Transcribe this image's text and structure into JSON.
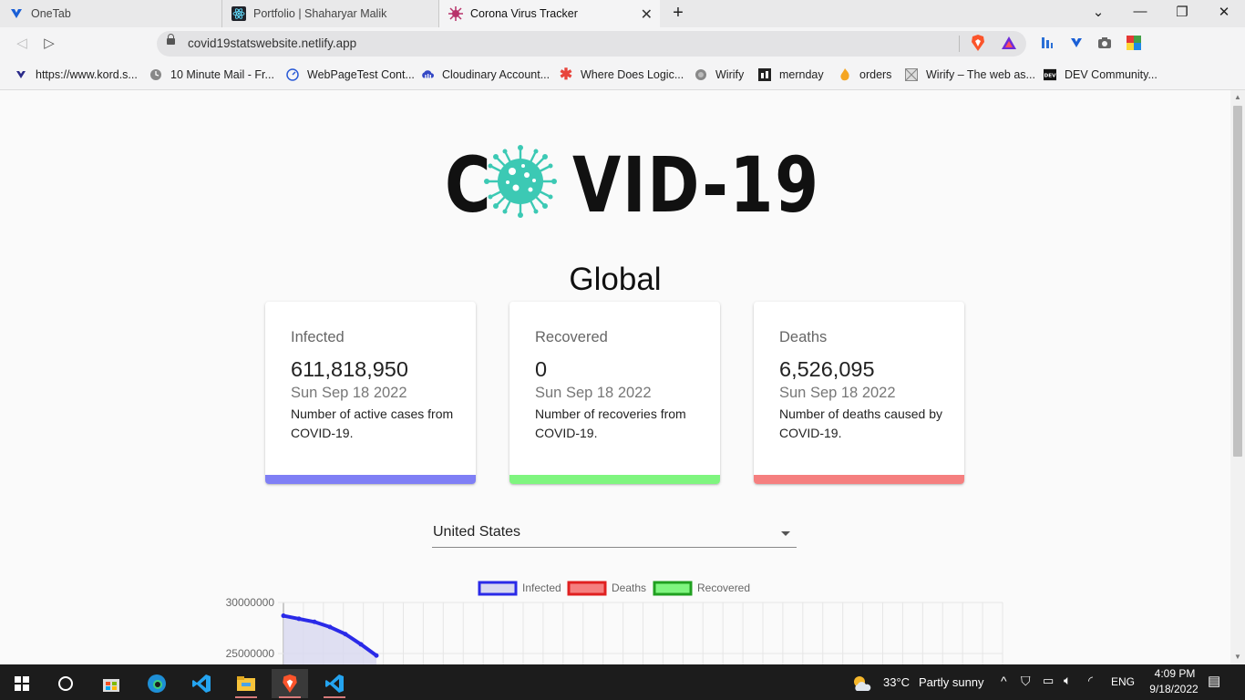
{
  "browser": {
    "tabs": [
      {
        "title": "OneTab",
        "active": false
      },
      {
        "title": "Portfolio | Shaharyar Malik",
        "active": false
      },
      {
        "title": "Corona Virus Tracker",
        "active": true
      }
    ],
    "url": "covid19statswebsite.netlify.app",
    "bookmarks": [
      {
        "label": "https://www.kord.s...",
        "icon": "kord-icon"
      },
      {
        "label": "10 Minute Mail - Fr...",
        "icon": "clock-icon"
      },
      {
        "label": "WebPageTest Cont...",
        "icon": "webpagetest-icon"
      },
      {
        "label": "Cloudinary Account...",
        "icon": "cloudinary-icon"
      },
      {
        "label": "Where Does Logic...",
        "icon": "asterisk-icon"
      },
      {
        "label": "Wirify",
        "icon": "globe-icon"
      },
      {
        "label": "mernday",
        "icon": "mernday-icon"
      },
      {
        "label": "orders",
        "icon": "flame-icon"
      },
      {
        "label": "Wirify – The web as...",
        "icon": "wirify-icon"
      },
      {
        "label": "DEV Community...",
        "icon": "dev-icon"
      }
    ]
  },
  "page": {
    "logo_letter_c": "C",
    "logo_rest": "VID-19",
    "global_title": "Global",
    "cards": [
      {
        "label": "Infected",
        "value": "611,818,950",
        "date": "Sun Sep 18 2022",
        "description": "Number of active cases from COVID-19.",
        "color": "#7f7ff5"
      },
      {
        "label": "Recovered",
        "value": "0",
        "date": "Sun Sep 18 2022",
        "description": "Number of recoveries from COVID-19.",
        "color": "#7ff57f"
      },
      {
        "label": "Deaths",
        "value": "6,526,095",
        "date": "Sun Sep 18 2022",
        "description": "Number of deaths caused by COVID-19.",
        "color": "#f57f7f"
      }
    ],
    "country_select": {
      "selected": "United States"
    }
  },
  "chart_data": {
    "type": "line",
    "legend": [
      {
        "name": "Infected",
        "stroke": "#2a2ae8",
        "fill": "#d8d8f0"
      },
      {
        "name": "Deaths",
        "stroke": "#e02020",
        "fill": "#f57f7f"
      },
      {
        "name": "Recovered",
        "stroke": "#20a020",
        "fill": "#7ff57f"
      }
    ],
    "legend_position": "top-center",
    "y_ticks": [
      "30000000",
      "25000000"
    ],
    "ylim": [
      25000000,
      30000000
    ],
    "grid": true,
    "series": [
      {
        "name": "Infected",
        "values": [
          28700000,
          28400000,
          28100000,
          27600000,
          26900000,
          25900000,
          24800000
        ]
      }
    ]
  },
  "taskbar": {
    "weather_temp": "33°C",
    "weather_desc": "Partly sunny",
    "language": "ENG",
    "time": "4:09 PM",
    "date": "9/18/2022"
  }
}
